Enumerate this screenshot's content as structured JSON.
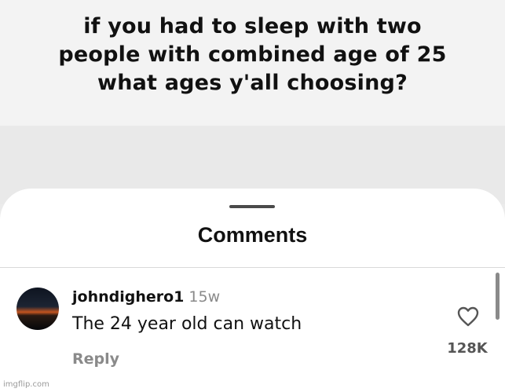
{
  "post": {
    "lines": [
      "if you had to sleep with two",
      "people with combined age of 25",
      "what ages y'all choosing?"
    ]
  },
  "comments_sheet": {
    "title": "Comments"
  },
  "comment": {
    "username": "johndighero1",
    "timestamp": "15w",
    "text": "The 24 year old can watch",
    "reply_label": "Reply",
    "like_count": "128K",
    "like_icon": "heart-outline-icon",
    "avatar": "sunset-avatar"
  },
  "watermark": "imgflip.com"
}
